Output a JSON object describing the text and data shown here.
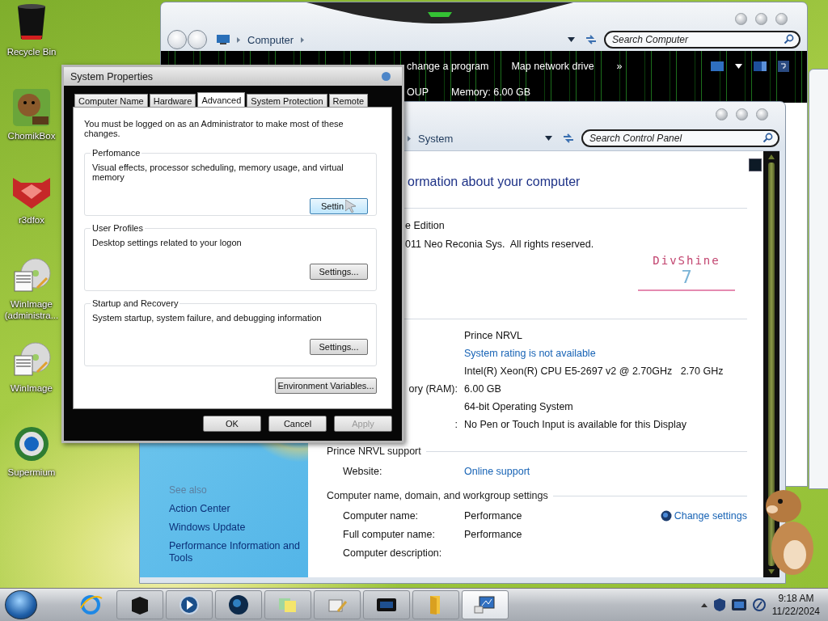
{
  "desktop_icons": [
    {
      "label": "Recycle Bin",
      "kind": "bin"
    },
    {
      "label": "ChomikBox",
      "kind": "chomik"
    },
    {
      "label": "r3dfox",
      "kind": "fox"
    },
    {
      "label": "WinImage (administra...",
      "kind": "disc"
    },
    {
      "label": "WinImage",
      "kind": "disc"
    },
    {
      "label": "Supermium",
      "kind": "browser"
    }
  ],
  "explorer": {
    "address": "Computer",
    "search": {
      "placeholder": "Search Computer"
    },
    "toolbar": [
      "change a program",
      "Map network drive",
      "»"
    ],
    "details": [
      "OUP",
      "Memory: 6.00 GB"
    ]
  },
  "control_panel": {
    "address": "System",
    "search": {
      "placeholder": "Search Control Panel"
    },
    "see_also": {
      "title": "See also",
      "links": [
        "Action Center",
        "Windows Update",
        "Performance Information and Tools"
      ]
    },
    "heading": "ormation about your computer",
    "edition": [
      "e Edition",
      "011 Neo Reconia Sys.  All rights reserved."
    ],
    "logo": {
      "name": "DivShine",
      "version": "7"
    },
    "system_rows": [
      {
        "value": "Prince NRVL",
        "kind": "text"
      },
      {
        "value": "System rating is not available",
        "kind": "link"
      },
      {
        "value": "Intel(R) Xeon(R) CPU E5-2697 v2 @ 2.70GHz   2.70 GHz",
        "kind": "text"
      },
      {
        "label": "ory (RAM):",
        "value": "6.00 GB",
        "kind": "text"
      },
      {
        "value": "64-bit Operating System",
        "kind": "text"
      },
      {
        "label": ":",
        "value": "No Pen or Touch Input is available for this Display",
        "kind": "text"
      }
    ],
    "sections": [
      {
        "title": "Prince NRVL support",
        "rows": [
          {
            "label": "Website:",
            "value": "Online support",
            "kind": "link"
          }
        ]
      },
      {
        "title": "Computer name, domain, and workgroup settings",
        "action": "Change settings",
        "rows": [
          {
            "label": "Computer name:",
            "value": "Performance",
            "kind": "text"
          },
          {
            "label": "Full computer name:",
            "value": "Performance",
            "kind": "text"
          },
          {
            "label": "Computer description:",
            "kind": "text"
          }
        ]
      }
    ]
  },
  "dialog": {
    "title": "System Properties",
    "tabs": [
      {
        "label": "Computer Name",
        "selected": false
      },
      {
        "label": "Hardware",
        "selected": false
      },
      {
        "label": "Advanced",
        "selected": true
      },
      {
        "label": "System Protection",
        "selected": false
      },
      {
        "label": "Remote",
        "selected": false
      }
    ],
    "notice": "You must be logged on as an Administrator to make most of these changes.",
    "groups": [
      {
        "title": "Perfomance",
        "description": "Visual effects, processor scheduling, memory usage, and virtual memory",
        "button": "Settin",
        "hovered": true
      },
      {
        "title": "User Profiles",
        "description": "Desktop settings related to your logon",
        "button": "Settings...",
        "hovered": false
      },
      {
        "title": "Startup and Recovery",
        "description": "System startup, system failure, and debugging information",
        "button": "Settings...",
        "hovered": false
      }
    ],
    "env_button": "Environment Variables...",
    "buttons": [
      {
        "label": "OK",
        "disabled": false
      },
      {
        "label": "Cancel",
        "disabled": false
      },
      {
        "label": "Apply",
        "disabled": true
      }
    ]
  },
  "taskbar": {
    "items": [
      {
        "kind": "ie",
        "open": false,
        "selected": false
      },
      {
        "kind": "box",
        "open": true,
        "selected": false
      },
      {
        "kind": "media",
        "open": true,
        "selected": false
      },
      {
        "kind": "globe",
        "open": true,
        "selected": false
      },
      {
        "kind": "notes",
        "open": true,
        "selected": false
      },
      {
        "kind": "tool",
        "open": true,
        "selected": false
      },
      {
        "kind": "monitor",
        "open": true,
        "selected": false
      },
      {
        "kind": "folder",
        "open": true,
        "selected": false
      },
      {
        "kind": "computer",
        "open": true,
        "selected": true
      }
    ],
    "clock": {
      "time": "9:18 AM",
      "date": "11/22/2024"
    }
  }
}
